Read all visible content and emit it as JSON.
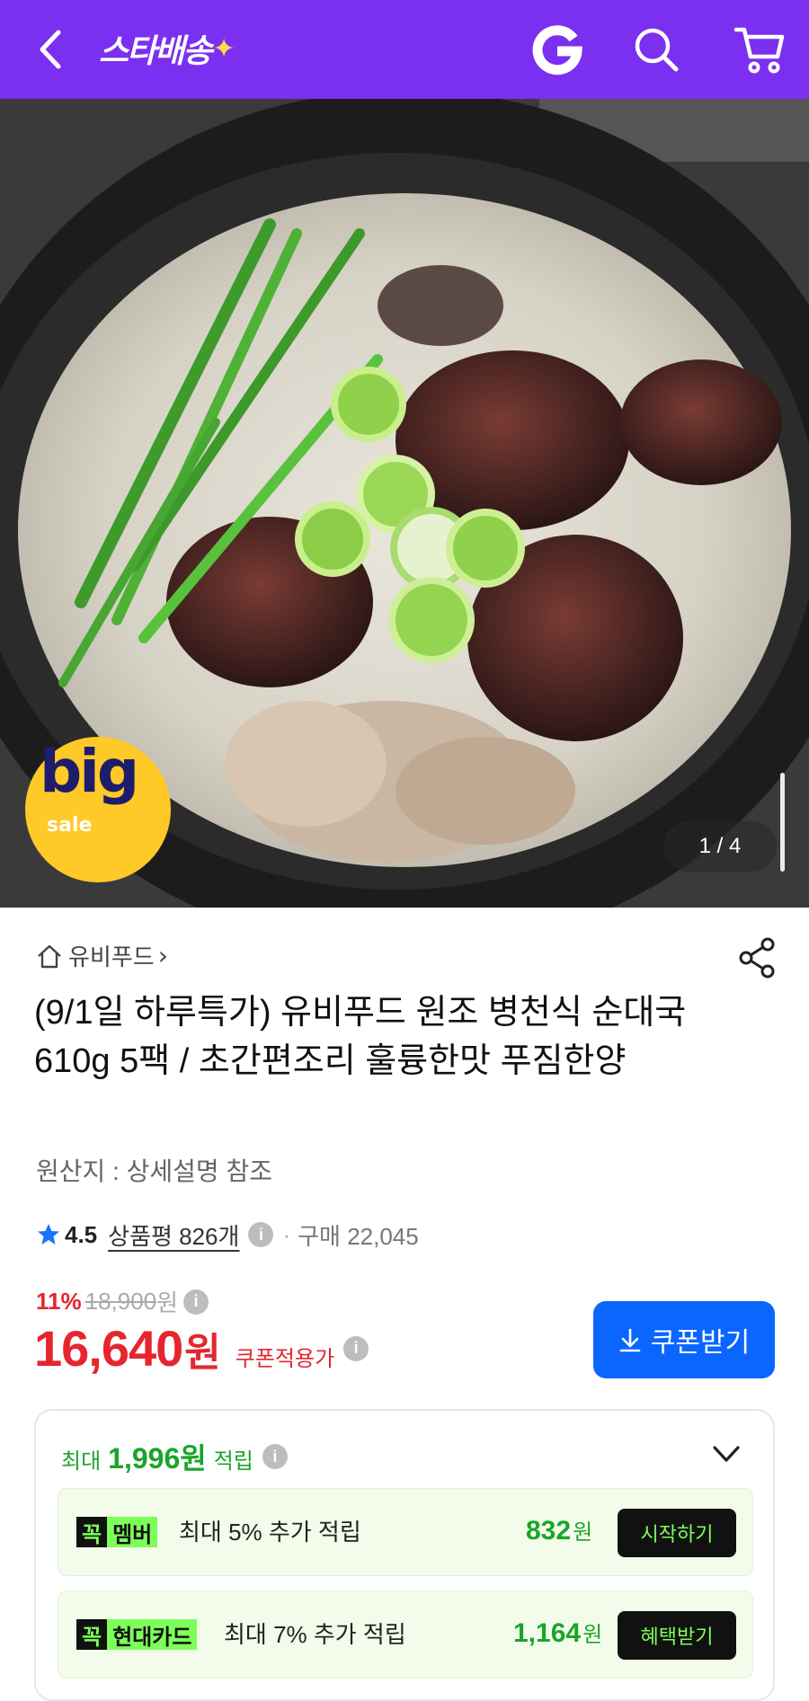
{
  "header": {
    "logo_text": "스타배송",
    "logo_star": "✦",
    "brand_color": "#7b2ff0",
    "icons": [
      "back-arrow-icon",
      "gmarket-g-icon",
      "search-icon",
      "cart-icon"
    ]
  },
  "hero": {
    "badge_big": "big",
    "badge_sale": "sale",
    "pager": "1 / 4"
  },
  "product": {
    "store_name": "유비푸드",
    "store_chevron": "›",
    "title": "(9/1일 하루특가) 유비푸드 원조 병천식 순대국 610g 5팩 / 초간편조리 훌륭한맛 푸짐한양",
    "origin": "원산지 : 상세설명 참조",
    "rating": "4.5",
    "reviews": "상품평 826개",
    "dot": "·",
    "purchases": "구매 22,045"
  },
  "price": {
    "discount": "11%",
    "original": "18,900",
    "original_unit": "원",
    "final": "16,640",
    "final_unit": "원",
    "coupon_note": "쿠폰적용가",
    "coupon_button": "쿠폰받기",
    "accent_red": "#e5262f",
    "button_blue": "#0a66ff"
  },
  "rewards": {
    "prefix": "최대",
    "amount": "1,996원",
    "suffix": "적립",
    "accent_green": "#1aa52a",
    "rows": [
      {
        "tag_k": "꼭",
        "tag_name": "멤버",
        "desc": "최대 5% 추가 적립",
        "amount": "832",
        "unit": "원",
        "button": "시작하기"
      },
      {
        "tag_k": "꼭",
        "tag_name": "현대카드",
        "desc": "최대 7% 추가 적립",
        "amount": "1,164",
        "unit": "원",
        "button": "혜택받기"
      }
    ]
  }
}
